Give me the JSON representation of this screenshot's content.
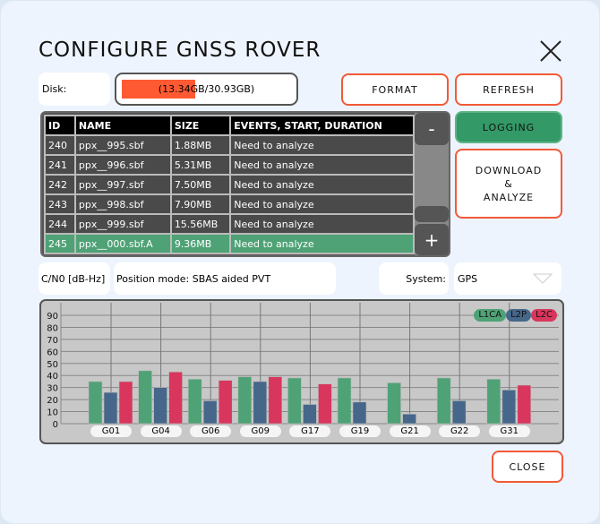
{
  "title": "CONFIGURE GNSS ROVER",
  "disk": {
    "label": "Disk:",
    "text": "(13.34GB/30.93GB)",
    "used_fraction": 0.431
  },
  "buttons": {
    "format": "FORMAT",
    "refresh": "REFRESH",
    "logging": "LOGGING",
    "download": [
      "DOWNLOAD",
      "&",
      "ANALYZE"
    ],
    "close": "CLOSE",
    "minus": "-",
    "plus": "+"
  },
  "table": {
    "columns": [
      "ID",
      "NAME",
      "SIZE",
      "EVENTS, START, DURATION"
    ],
    "rows": [
      [
        "240",
        "ppx__995.sbf",
        "1.88MB",
        "Need to analyze"
      ],
      [
        "241",
        "ppx__996.sbf",
        "5.31MB",
        "Need to analyze"
      ],
      [
        "242",
        "ppx__997.sbf",
        "7.50MB",
        "Need to analyze"
      ],
      [
        "243",
        "ppx__998.sbf",
        "7.90MB",
        "Need to analyze"
      ],
      [
        "244",
        "ppx__999.sbf",
        "15.56MB",
        "Need to analyze"
      ],
      [
        "245",
        "ppx__000.sbf.A",
        "9.36MB",
        "Need to analyze"
      ]
    ],
    "selected_index": 5
  },
  "status": {
    "cn0": "C/N0 [dB-Hz]",
    "position_mode": "Position mode: SBAS aided PVT",
    "system_label": "System:",
    "system_value": "GPS"
  },
  "colors": {
    "accent": "#f25a37",
    "logging": "#339966",
    "L1CA": "#4fa276",
    "L2P": "#46678a",
    "L2C": "#d8365d"
  },
  "chart_data": {
    "type": "bar",
    "categories": [
      "G01",
      "G04",
      "G06",
      "G09",
      "G17",
      "G19",
      "G21",
      "G22",
      "G31"
    ],
    "series": [
      {
        "name": "L1CA",
        "values": [
          35,
          44,
          37,
          39,
          38,
          38,
          34,
          38,
          37
        ]
      },
      {
        "name": "L2P",
        "values": [
          26,
          30,
          19,
          35,
          16,
          18,
          8,
          19,
          28
        ]
      },
      {
        "name": "L2C",
        "values": [
          35,
          43,
          36,
          39,
          33,
          0,
          0,
          0,
          32
        ]
      }
    ],
    "yticks": [
      0,
      10,
      20,
      30,
      40,
      50,
      60,
      70,
      80,
      90
    ],
    "ylim": [
      0,
      100
    ],
    "grid": true,
    "legend": "top-right"
  }
}
